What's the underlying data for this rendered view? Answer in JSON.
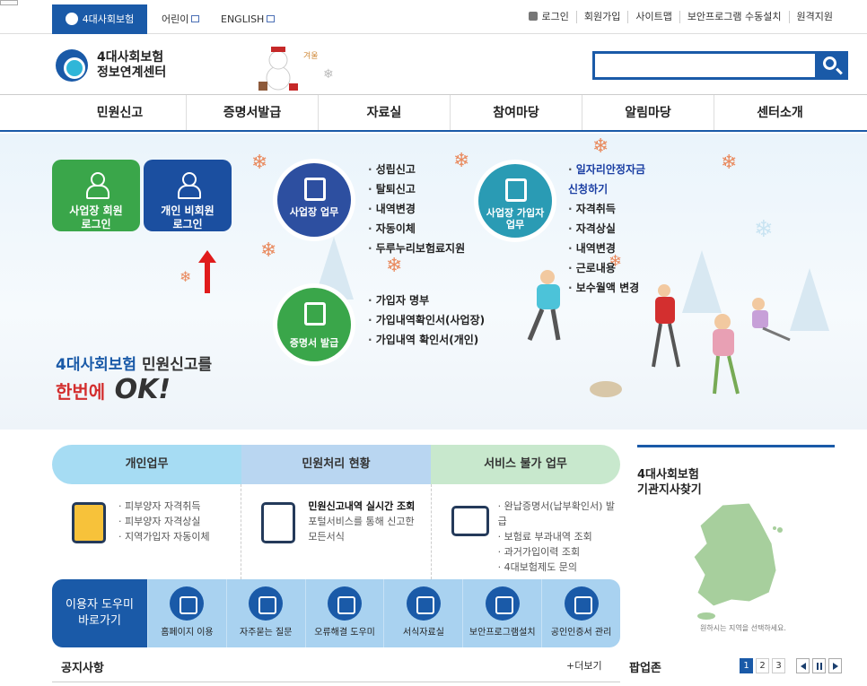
{
  "topbar": {
    "active_tab": "4대사회보험",
    "kids_tab": "어린이",
    "english_tab": "ENGLISH",
    "utils": [
      "로그인",
      "회원가입",
      "사이트맵",
      "보안프로그램 수동설치",
      "원격지원"
    ]
  },
  "header": {
    "logo_line1": "4대사회보험",
    "logo_line2": "정보연계센터",
    "search_placeholder": ""
  },
  "gnb": [
    "민원신고",
    "증명서발급",
    "자료실",
    "참여마당",
    "알림마당",
    "센터소개"
  ],
  "visual": {
    "biz_login": "사업장 회원\n로그인",
    "pers_login": "개인 비회원\n로그인",
    "circle1": "사업장 업무",
    "circle2": "사업장 가입자\n업무",
    "circle3": "증명서 발급",
    "list1": [
      "성립신고",
      "탈퇴신고",
      "내역변경",
      "자동이체",
      "두루누리보험료지원"
    ],
    "list2": [
      "일자리안정자금\n신청하기",
      "자격취득",
      "자격상실",
      "내역변경",
      "근로내용",
      "보수월액 변경"
    ],
    "list3": [
      "가입자 명부",
      "가입내역확인서(사업장)",
      "가입내역 확인서(개인)"
    ],
    "tag_brand": "4대사회보험",
    "tag_rest": "민원신고를",
    "tag_small": "한번에",
    "tag_big": "OK!"
  },
  "services": {
    "tabs": [
      "개인업무",
      "민원처리 현황",
      "서비스 불가 업무"
    ],
    "col1": [
      "피부양자 자격취득",
      "피부양자 자격상실",
      "지역가입자 자동이체"
    ],
    "col2_title": "민원신고내역 실시간 조회",
    "col2_text": [
      "포털서비스를 통해 신고한",
      "모든서식"
    ],
    "col3": [
      "완납증명서(납부확인서) 발급",
      "보험료 부과내역 조회",
      "과거가입이력 조회",
      "4대보험제도 문의"
    ]
  },
  "helper": {
    "title": "이용자 도우미\n바로가기",
    "items": [
      "홈페이지 이용",
      "자주묻는 질문",
      "오류해결 도우미",
      "서식자료실",
      "보안프로그램설치",
      "공인인증서 관리"
    ]
  },
  "notice": {
    "title": "공지사항",
    "more": "+더보기"
  },
  "popup": {
    "title": "팝업존",
    "pages": [
      "1",
      "2",
      "3"
    ]
  },
  "map": {
    "title": "4대사회보험\n기관지사찾기",
    "caption": "원하시는 지역을 선택하세요."
  },
  "colors": {
    "primary": "#1a5aa8",
    "green": "#3aa64a",
    "teal": "#2a9bb4",
    "accent_red": "#d32f2f"
  }
}
